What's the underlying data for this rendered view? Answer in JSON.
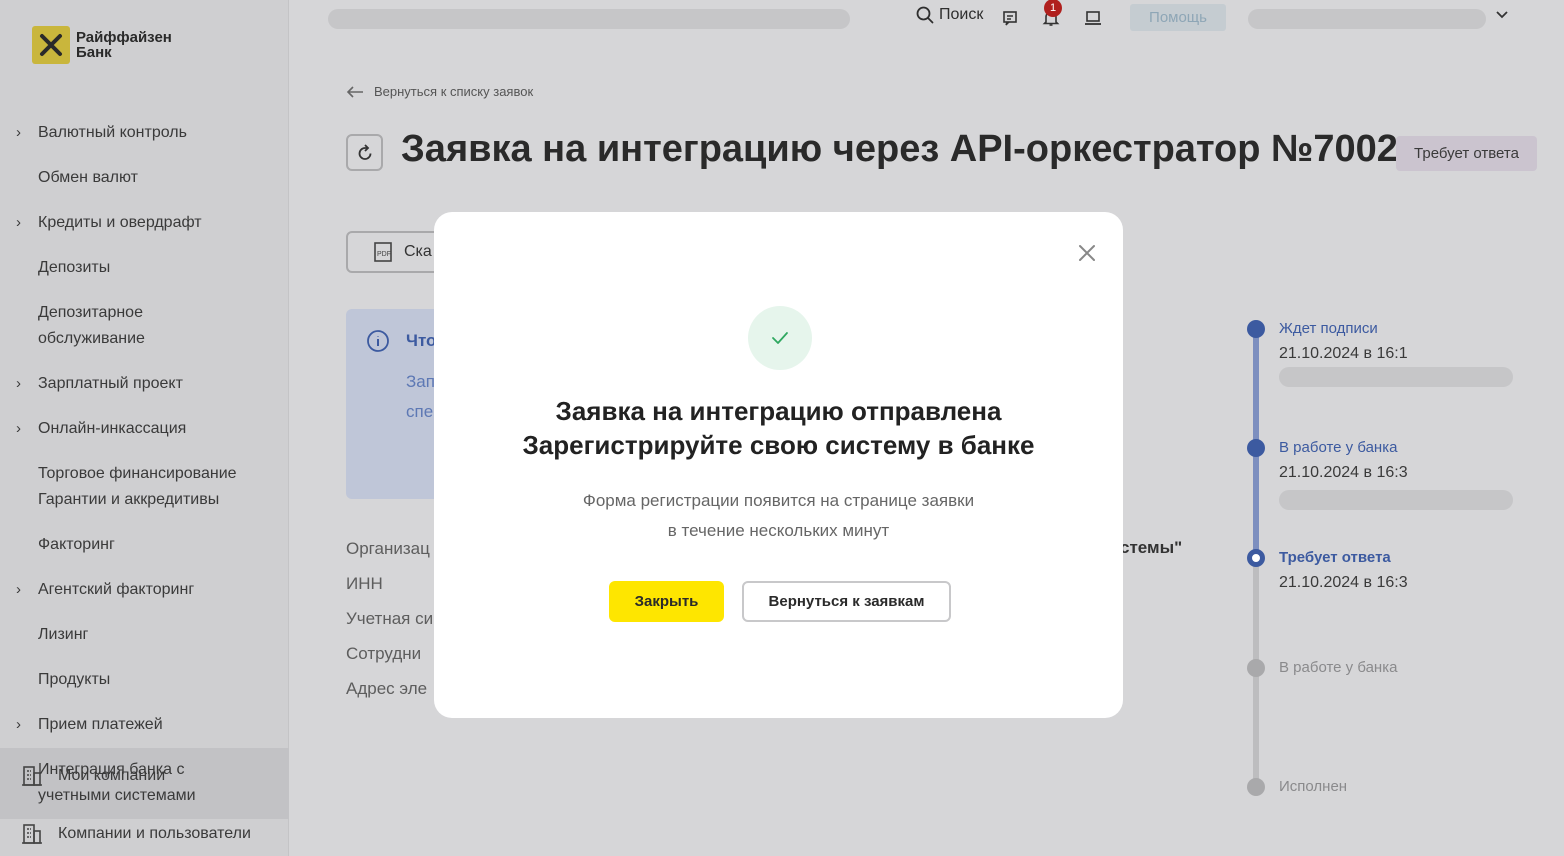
{
  "logo": {
    "line1": "Райффайзен",
    "line2": "Банк"
  },
  "sidebar": {
    "items": [
      {
        "label": "Валютный контроль",
        "has_children": true
      },
      {
        "label": "Обмен валют",
        "has_children": false
      },
      {
        "label": "Кредиты и овердрафт",
        "has_children": true
      },
      {
        "label": "Депозиты",
        "has_children": false
      },
      {
        "label": "Депозитарное обслуживание",
        "has_children": false
      },
      {
        "label": "Зарплатный проект",
        "has_children": true
      },
      {
        "label": "Онлайн-инкассация",
        "has_children": true
      },
      {
        "label": "Торговое финансирование Гарантии и аккредитивы",
        "has_children": false
      },
      {
        "label": "Факторинг",
        "has_children": false
      },
      {
        "label": "Агентский факторинг",
        "has_children": true
      },
      {
        "label": "Лизинг",
        "has_children": false
      },
      {
        "label": "Продукты",
        "has_children": false
      },
      {
        "label": "Прием платежей",
        "has_children": true
      },
      {
        "label": "Интеграция банка с учетными системами",
        "has_children": false,
        "active": true
      }
    ],
    "my_companies": "Мои компании",
    "companies_users": "Компании и пользователи"
  },
  "topbar": {
    "search_label": "Поиск",
    "notification_count": "1",
    "help_label": "Помощь"
  },
  "page": {
    "back_link": "Вернуться к списку заявок",
    "title": "Заявка на интеграцию через API-оркестратор №7002",
    "status": "Требует ответа",
    "download_label": "Ска",
    "info_title": "Что",
    "info_line1": "Зап",
    "info_line2": "спе",
    "fields": [
      "Организац",
      "ИНН",
      "Учетная си",
      "Сотрудни",
      "Адрес эле"
    ],
    "org_value_fragment": "стемы\""
  },
  "timeline": [
    {
      "title": "Ждет подписи",
      "date": "21.10.2024 в 16:1",
      "state": "done"
    },
    {
      "title": "В работе у банка",
      "date": "21.10.2024 в 16:3",
      "state": "done"
    },
    {
      "title": "Требует ответа",
      "date": "21.10.2024 в 16:3",
      "state": "current"
    },
    {
      "title": "В работе у банка",
      "date": "",
      "state": "pending"
    },
    {
      "title": "Исполнен",
      "date": "",
      "state": "pending"
    }
  ],
  "modal": {
    "title_line1": "Заявка на интеграцию отправлена",
    "title_line2": "Зарегистрируйте свою систему в банке",
    "text_line1": "Форма регистрации появится на странице заявки",
    "text_line2": "в течение нескольких минут",
    "primary_button": "Закрыть",
    "secondary_button": "Вернуться к заявкам"
  },
  "colors": {
    "accent_yellow": "#fee600",
    "timeline_blue": "#3c5aa0",
    "success_green": "#2fa860",
    "badge_red": "#b0201e"
  }
}
